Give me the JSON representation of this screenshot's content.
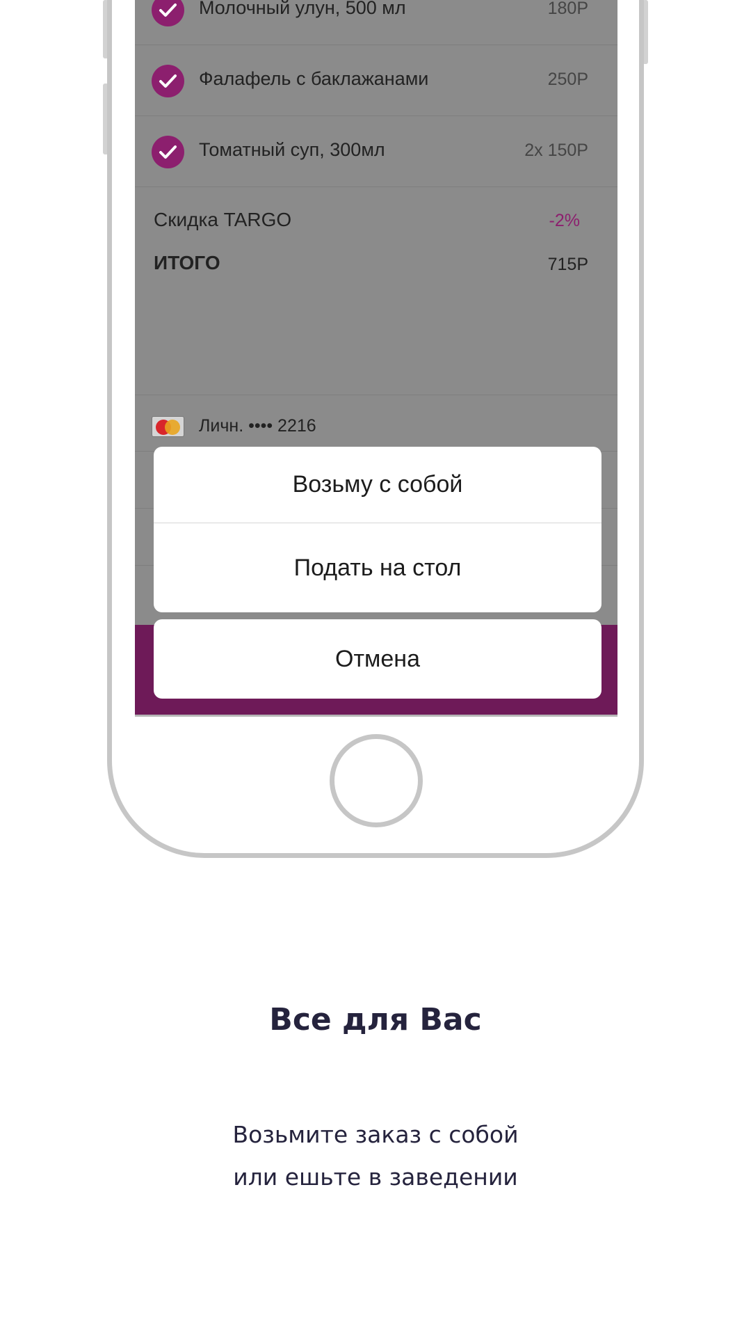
{
  "order": {
    "items": [
      {
        "name": "Молочный улун, 500 мл",
        "price": "180Р"
      },
      {
        "name": "Фалафель с баклажанами",
        "price": "250Р"
      },
      {
        "name": "Томатный суп, 300мл",
        "price": "2x 150Р"
      }
    ],
    "discount_label": "Скидка TARGO",
    "discount_value": "-2%",
    "total_label": "ИТОГО",
    "total_value": "715Р"
  },
  "payment": {
    "card_icon": "mastercard-icon",
    "card_text": "Личн. •••• 2216"
  },
  "action_sheet": {
    "option_1": "Возьму с собой",
    "option_2": "Подать на стол",
    "cancel": "Отмена"
  },
  "promo": {
    "headline": "Все для Вас",
    "line_1": "Возьмите заказ с собой",
    "line_2": "или ешьте в заведении"
  },
  "colors": {
    "accent": "#8c1f6e",
    "overlay_gray": "#8b8b8b",
    "text_dark": "#25233d"
  }
}
